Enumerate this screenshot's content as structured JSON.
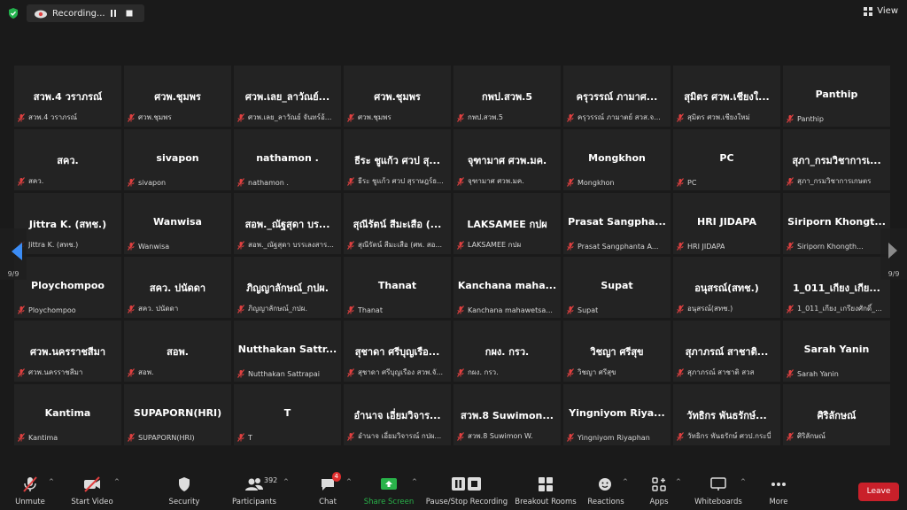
{
  "recording": {
    "label": "Recording..."
  },
  "view": {
    "label": "View"
  },
  "pagination": {
    "left": "9/9",
    "right": "9/9"
  },
  "tiles": [
    {
      "name": "สวพ.4 วราภรณ์",
      "label": "สวพ.4 วราภรณ์"
    },
    {
      "name": "ศวพ.ชุมพร",
      "label": "ศวพ.ชุมพร"
    },
    {
      "name": "ศวพ.เลย_ลาวัณย์...",
      "label": "ศวพ.เลย_ลาวัณย์ จันทร์อ้..."
    },
    {
      "name": "ศวพ.ชุมพร",
      "label": "ศวพ.ชุมพร"
    },
    {
      "name": "กพป.สวพ.5",
      "label": "กพป.สวพ.5"
    },
    {
      "name": "ครุวรรณ์ ภามาศ...",
      "label": "ครุวรรณ์ ภามาตย์ สวส.จ..."
    },
    {
      "name": "สุมิตร ศวพ.เชียงใ...",
      "label": "สุมิตร ศวพ.เชียงใหม่"
    },
    {
      "name": "Panthip",
      "label": "Panthip"
    },
    {
      "name": "สคว.",
      "label": "สคว."
    },
    {
      "name": "sivapon",
      "label": "sivapon"
    },
    {
      "name": "nathamon .",
      "label": "nathamon ."
    },
    {
      "name": "ธีระ ชูแก้ว ศวป สุ...",
      "label": "ธีระ ชูแก้ว ศวป สุราษฎร์ธ..."
    },
    {
      "name": "จุฑามาศ ศวพ.มค.",
      "label": "จุฑามาศ ศวพ.มค."
    },
    {
      "name": "Mongkhon",
      "label": "Mongkhon"
    },
    {
      "name": "PC",
      "label": "PC"
    },
    {
      "name": "สุภา_กรมวิชาการเ...",
      "label": "สุภา_กรมวิชาการเกษตร"
    },
    {
      "name": "Jittra K. (สทช.)",
      "label": "Jittra K. (สทช.)"
    },
    {
      "name": "Wanwisa",
      "label": "Wanwisa"
    },
    {
      "name": "สอพ._ณัฐสุดา บร...",
      "label": "สอพ._ณัฐสุดา บรรเลงสาร..."
    },
    {
      "name": "สุณีรัตน์ สีมะเสือ (...",
      "label": "สุณีรัตน์ สีมะเสือ (ศพ. สอ..."
    },
    {
      "name": "LAKSAMEE กปผ",
      "label": "LAKSAMEE กปผ"
    },
    {
      "name": "Prasat Sangpha...",
      "label": "Prasat Sangphanta A..."
    },
    {
      "name": "HRI JIDAPA",
      "label": "HRI JIDAPA"
    },
    {
      "name": "Siriporn Khongt...",
      "label": "Siriporn Khongth..."
    },
    {
      "name": "Ploychompoo",
      "label": "Ploychompoo"
    },
    {
      "name": "สคว. ปนัดดา",
      "label": "สคว. ปนัดดา"
    },
    {
      "name": "ภิญญาลักษณ์_กปผ.",
      "label": "ภิญญาลักษณ์_กปผ."
    },
    {
      "name": "Thanat",
      "label": "Thanat"
    },
    {
      "name": "Kanchana maha...",
      "label": "Kanchana mahawetsa..."
    },
    {
      "name": "Supat",
      "label": "Supat"
    },
    {
      "name": "อนุสรณ์(สทช.)",
      "label": "อนุสรณ์(สทช.)"
    },
    {
      "name": "1_011_เกียง_เกีย...",
      "label": "1_011_เกียง_เกรียงศักดิ์_..."
    },
    {
      "name": "ศวพ.นครราชสีมา",
      "label": "ศวพ.นครราชสีมา"
    },
    {
      "name": "สอพ.",
      "label": "สอพ."
    },
    {
      "name": "Nutthakan Sattr...",
      "label": "Nutthakan Sattrapai"
    },
    {
      "name": "สุชาดา ศรีบุญเรือ...",
      "label": "สุชาดา ศรีบุญเรือง สวพ.จั..."
    },
    {
      "name": "กผง. กรว.",
      "label": "กผง. กรว."
    },
    {
      "name": "วิชญา ศรีสุข",
      "label": "วิชญา ศรีสุข"
    },
    {
      "name": "สุภาภรณ์ สาชาติ...",
      "label": "สุภาภรณ์ สาชาติ สวส"
    },
    {
      "name": "Sarah Yanin",
      "label": "Sarah Yanin"
    },
    {
      "name": "Kantima",
      "label": "Kantima"
    },
    {
      "name": "SUPAPORN(HRI)",
      "label": "SUPAPORN(HRI)"
    },
    {
      "name": "T",
      "label": "T"
    },
    {
      "name": "อำนาจ เอี่ยมวิจาร...",
      "label": "อำนาจ เอี่ยมวิจารณ์ กปผ..."
    },
    {
      "name": "สวพ.8 Suwimon...",
      "label": "สวพ.8 Suwimon W."
    },
    {
      "name": "Yingniyom Riya...",
      "label": "Yingniyom Riyaphan"
    },
    {
      "name": "วัทธิกร พันธรักษ์...",
      "label": "วัทธิกร พันธรักษ์ ศวป.กระบี่"
    },
    {
      "name": "ศิริลักษณ์",
      "label": "ศิริลักษณ์"
    }
  ],
  "toolbar": {
    "unmute": "Unmute",
    "start_video": "Start Video",
    "security": "Security",
    "participants": "Participants",
    "participants_count": "392",
    "chat": "Chat",
    "chat_badge": "4",
    "share_screen": "Share Screen",
    "pause_stop": "Pause/Stop Recording",
    "breakout": "Breakout Rooms",
    "reactions": "Reactions",
    "apps": "Apps",
    "whiteboards": "Whiteboards",
    "more": "More",
    "leave": "Leave"
  },
  "colors": {
    "accent": "#3b8cf5",
    "leave": "#c9202a",
    "share": "#29b34a",
    "muted": "#e04040"
  }
}
